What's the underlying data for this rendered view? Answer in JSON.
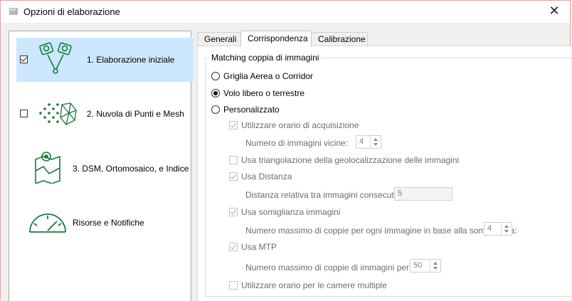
{
  "window": {
    "title": "Opzioni di elaborazione"
  },
  "steps": [
    {
      "label": "1. Elaborazione iniziale",
      "checked": true,
      "selected": true,
      "icon": "camera-pair-icon"
    },
    {
      "label": "2. Nuvola di Punti e Mesh",
      "checked": false,
      "selected": false,
      "icon": "point-cloud-icon"
    },
    {
      "label": "3. DSM, Ortomosaico, e Indice",
      "checked": null,
      "selected": false,
      "icon": "map-icon"
    },
    {
      "label": "Risorse e Notifiche",
      "checked": null,
      "selected": false,
      "icon": "gauge-icon"
    }
  ],
  "tabs": [
    {
      "label": "Generali",
      "active": false
    },
    {
      "label": "Corrispondenza",
      "active": true
    },
    {
      "label": "Calibrazione",
      "active": false
    }
  ],
  "matching": {
    "legend": "Matching coppia di immagini",
    "radio_aerial": "Griglia Aerea o Corridor",
    "radio_free": "Volo libero o terrestre",
    "radio_custom": "Personalizzato",
    "use_time": "Utilizzare orario di acquisizione",
    "neighbors_label": "Numero di immagini vicine:",
    "neighbors_value": "4",
    "use_triangulation": "Usa triangolazione della geolocalizzazione delle immagini",
    "use_distance": "Usa Distanza",
    "distance_label": "Distanza relativa tra immagini consecutive:",
    "distance_value": "5",
    "use_similarity": "Usa somiglianza immagini",
    "similarity_label": "Numero massimo di coppie per ogni immagine in base alla somiglianza:",
    "similarity_value": "4",
    "use_mtp": "Usa MTP",
    "mtp_label": "Numero massimo di coppie di immagini per MTP:",
    "mtp_value": "50",
    "use_multi_camera_time": "Utilizzare orario per le camere multiple"
  }
}
